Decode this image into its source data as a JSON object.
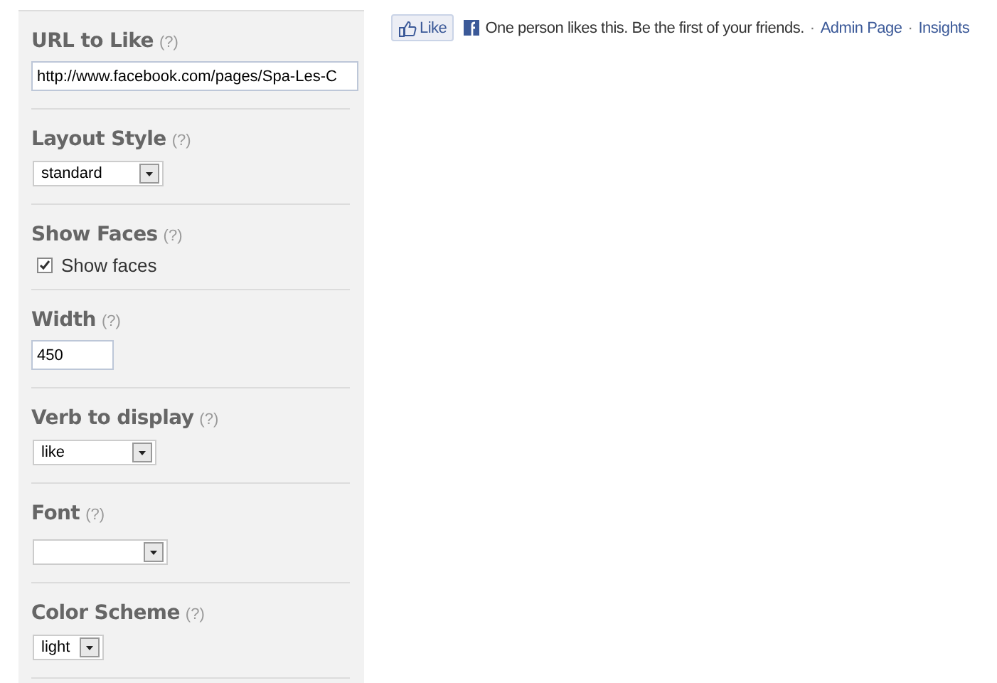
{
  "settings": [
    {
      "kind": "text",
      "label": "URL to Like",
      "help": "(?)",
      "value": "http://www.facebook.com/pages/Spa-Les-C"
    },
    {
      "kind": "select",
      "label": "Layout Style",
      "help": "(?)",
      "value": "standard"
    },
    {
      "kind": "checkbox",
      "label": "Show Faces",
      "help": "(?)",
      "option": "Show faces",
      "checked": true
    },
    {
      "kind": "text",
      "label": "Width",
      "help": "(?)",
      "value": "450"
    },
    {
      "kind": "select",
      "label": "Verb to display",
      "help": "(?)",
      "value": "like"
    },
    {
      "kind": "select",
      "label": "Font",
      "help": "(?)"
    },
    {
      "kind": "select",
      "label": "Color Scheme",
      "help": "(?)",
      "value": "light"
    }
  ],
  "preview": {
    "button": "Like",
    "sentence": "One person likes this. Be the first of your friends.",
    "separator": "·",
    "links": [
      "Admin Page",
      "Insights"
    ]
  }
}
